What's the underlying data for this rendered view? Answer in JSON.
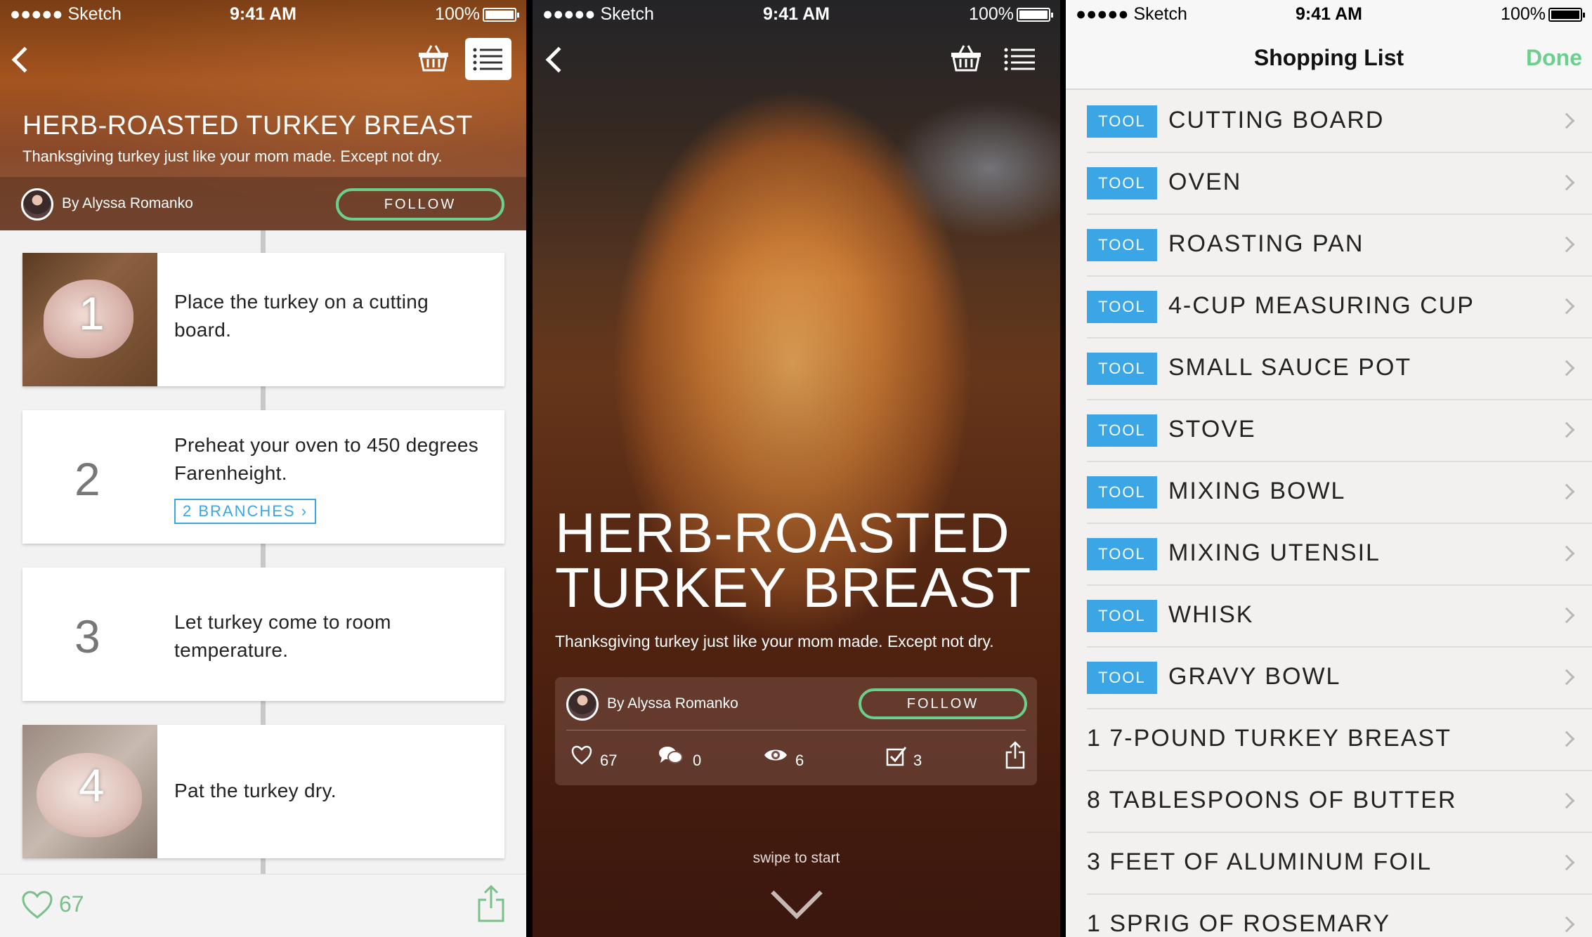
{
  "status_bar": {
    "carrier": "●●●●● Sketch",
    "time": "9:41 AM",
    "battery": "100%"
  },
  "colors": {
    "accent_green": "#6ccf8e",
    "accent_blue": "#3aa6e6"
  },
  "screen1": {
    "title": "HERB-ROASTED TURKEY BREAST",
    "subtitle": "Thanksgiving turkey just like your mom made. Except not dry.",
    "author": "By Alyssa Romanko",
    "follow_label": "FOLLOW",
    "steps": [
      {
        "number": "1",
        "text": "Place the turkey on a cutting board."
      },
      {
        "number": "2",
        "text": "Preheat your oven to 450 degrees Farenheight.",
        "branches": "2 BRANCHES ›"
      },
      {
        "number": "3",
        "text": "Let turkey come to room temperature."
      },
      {
        "number": "4",
        "text": "Pat the turkey dry."
      }
    ],
    "likes": "67"
  },
  "screen2": {
    "title": "HERB-ROASTED TURKEY BREAST",
    "subtitle": "Thanksgiving turkey just like your mom made. Except not dry.",
    "author": "By Alyssa Romanko",
    "follow_label": "FOLLOW",
    "stats": {
      "likes": "67",
      "comments": "0",
      "views": "6",
      "completed": "3"
    },
    "swipe_hint": "swipe to start"
  },
  "screen3": {
    "nav_title": "Shopping List",
    "done_label": "Done",
    "items": [
      {
        "tag": "TOOL",
        "name": "CUTTING BOARD"
      },
      {
        "tag": "TOOL",
        "name": "OVEN"
      },
      {
        "tag": "TOOL",
        "name": "ROASTING PAN"
      },
      {
        "tag": "TOOL",
        "name": "4-CUP MEASURING CUP"
      },
      {
        "tag": "TOOL",
        "name": "SMALL SAUCE POT"
      },
      {
        "tag": "TOOL",
        "name": "STOVE"
      },
      {
        "tag": "TOOL",
        "name": "MIXING BOWL"
      },
      {
        "tag": "TOOL",
        "name": "MIXING UTENSIL"
      },
      {
        "tag": "TOOL",
        "name": "WHISK"
      },
      {
        "tag": "TOOL",
        "name": "GRAVY BOWL"
      },
      {
        "tag": "",
        "name": "1 7-POUND TURKEY BREAST"
      },
      {
        "tag": "",
        "name": "8 TABLESPOONS OF BUTTER"
      },
      {
        "tag": "",
        "name": "3 FEET OF ALUMINUM FOIL"
      },
      {
        "tag": "",
        "name": "1 SPRIG OF ROSEMARY"
      }
    ]
  }
}
